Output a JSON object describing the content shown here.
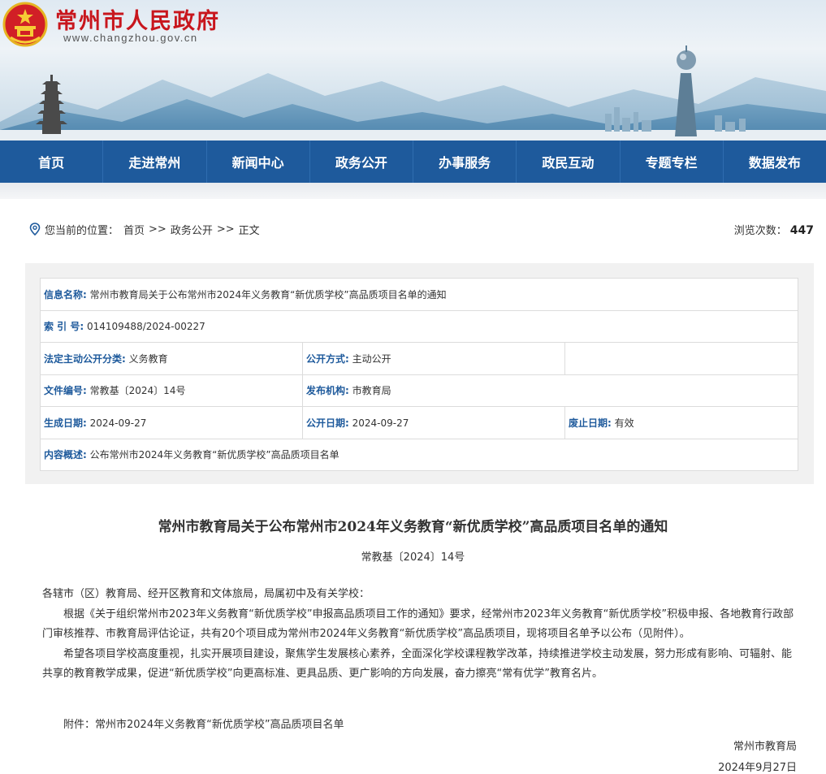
{
  "header": {
    "site_title": "常州市人民政府",
    "site_url": "www.changzhou.gov.cn",
    "emblem_icon": "national-emblem-icon",
    "brand_color": "#c8161d"
  },
  "nav": {
    "background": "#1e5a9c",
    "items": [
      "首页",
      "走进常州",
      "新闻中心",
      "政务公开",
      "办事服务",
      "政民互动",
      "专题专栏",
      "数据发布"
    ]
  },
  "breadcrumb": {
    "prefix": "您当前的位置：",
    "items": [
      "首页",
      "政务公开",
      "正文"
    ],
    "separator": ">>",
    "views_label": "浏览次数：",
    "views_value": "447"
  },
  "info": {
    "name_label": "信息名称:",
    "name_value": "常州市教育局关于公布常州市2024年义务教育“新优质学校”高品质项目名单的通知",
    "index_label": "索 引 号:",
    "index_value": "014109488/2024-00227",
    "category_label": "法定主动公开分类:",
    "category_value": "义务教育",
    "method_label": "公开方式:",
    "method_value": "主动公开",
    "docno_label": "文件编号:",
    "docno_value": "常教基〔2024〕14号",
    "issuer_label": "发布机构:",
    "issuer_value": "市教育局",
    "created_label": "生成日期:",
    "created_value": "2024-09-27",
    "published_label": "公开日期:",
    "published_value": "2024-09-27",
    "expiry_label": "废止日期:",
    "expiry_value": "有效",
    "summary_label": "内容概述:",
    "summary_value": "公布常州市2024年义务教育“新优质学校”高品质项目名单"
  },
  "article": {
    "title": "常州市教育局关于公布常州市2024年义务教育“新优质学校”高品质项目名单的通知",
    "doc_number": "常教基〔2024〕14号",
    "salutation": "各辖市（区）教育局、经开区教育和文体旅局，局属初中及有关学校：",
    "para1": "根据《关于组织常州市2023年义务教育“新优质学校”申报高品质项目工作的通知》要求，经常州市2023年义务教育“新优质学校”积极申报、各地教育行政部门审核推荐、市教育局评估论证，共有20个项目成为常州市2024年义务教育“新优质学校”高品质项目，现将项目名单予以公布（见附件）。",
    "para2": "希望各项目学校高度重视，扎实开展项目建设，聚焦学生发展核心素养，全面深化学校课程教学改革，持续推进学校主动发展，努力形成有影响、可辐射、能共享的教育教学成果，促进“新优质学校”向更高标准、更具品质、更广影响的方向发展，奋力擦亮“常有优学”教育名片。",
    "attachment": "附件：常州市2024年义务教育“新优质学校”高品质项目名单",
    "signer": "常州市教育局",
    "date": "2024年9月27日"
  }
}
